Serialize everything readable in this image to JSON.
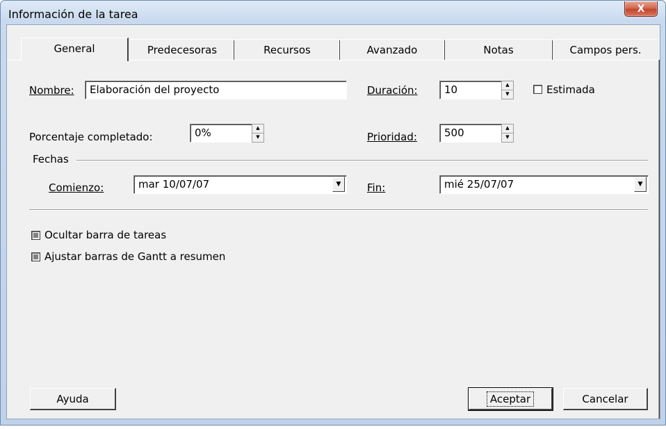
{
  "window": {
    "title": "Información de la tarea",
    "close_label": "X"
  },
  "tabs": [
    {
      "label": "General"
    },
    {
      "label": "Predecesoras"
    },
    {
      "label": "Recursos"
    },
    {
      "label": "Avanzado"
    },
    {
      "label": "Notas"
    },
    {
      "label": "Campos pers."
    }
  ],
  "form": {
    "nombre_label": "Nombre:",
    "nombre_value": "Elaboración del proyecto",
    "duracion_label": "Duración:",
    "duracion_value": "10",
    "estimada_label": "Estimada",
    "porcentaje_label": "Porcentaje completado:",
    "porcentaje_value": "0%",
    "prioridad_label": "Prioridad:",
    "prioridad_value": "500",
    "fechas_label": "Fechas",
    "comienzo_label": "Comienzo:",
    "comienzo_value": "mar 10/07/07",
    "fin_label": "Fin:",
    "fin_value": "mié 25/07/07",
    "ocultar_label": "Ocultar barra de tareas",
    "ajustar_label": "Ajustar barras de Gantt a resumen"
  },
  "buttons": {
    "ayuda": "Ayuda",
    "aceptar": "Aceptar",
    "cancelar": "Cancelar"
  }
}
